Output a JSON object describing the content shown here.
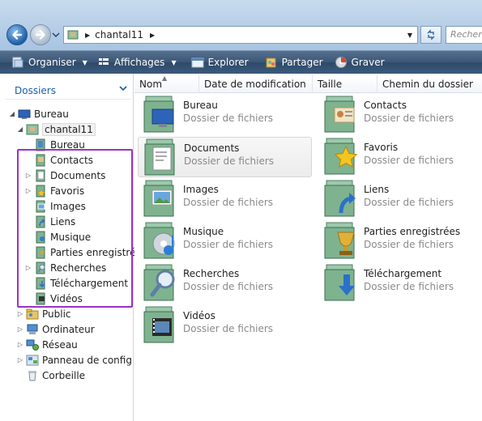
{
  "address": {
    "path": "chantal11",
    "search_placeholder": "Recherche"
  },
  "toolbar": {
    "organize": "Organiser",
    "views": "Affichages",
    "explore": "Explorer",
    "share": "Partager",
    "burn": "Graver"
  },
  "nav": {
    "header": "Dossiers",
    "tree": [
      {
        "label": "Bureau",
        "icon": "desktop-icon"
      },
      {
        "label": "chantal11",
        "icon": "user-folder-icon"
      },
      {
        "label": "Bureau",
        "icon": "desktop-folder-icon"
      },
      {
        "label": "Contacts",
        "icon": "contacts-folder-icon"
      },
      {
        "label": "Documents",
        "icon": "documents-folder-icon"
      },
      {
        "label": "Favoris",
        "icon": "favorites-folder-icon"
      },
      {
        "label": "Images",
        "icon": "pictures-folder-icon"
      },
      {
        "label": "Liens",
        "icon": "links-folder-icon"
      },
      {
        "label": "Musique",
        "icon": "music-folder-icon"
      },
      {
        "label": "Parties enregistrées",
        "icon": "saved-games-folder-icon"
      },
      {
        "label": "Recherches",
        "icon": "searches-folder-icon"
      },
      {
        "label": "Téléchargement",
        "icon": "downloads-folder-icon"
      },
      {
        "label": "Vidéos",
        "icon": "videos-folder-icon"
      },
      {
        "label": "Public",
        "icon": "public-folder-icon"
      },
      {
        "label": "Ordinateur",
        "icon": "computer-icon"
      },
      {
        "label": "Réseau",
        "icon": "network-icon"
      },
      {
        "label": "Panneau de configuration",
        "icon": "control-panel-icon"
      },
      {
        "label": "Corbeille",
        "icon": "recycle-bin-icon"
      }
    ]
  },
  "columns": {
    "name": "Nom",
    "modified": "Date de modification",
    "size": "Taille",
    "path": "Chemin du dossier"
  },
  "items": [
    {
      "name": "Bureau",
      "type": "Dossier de fichiers",
      "icon": "desktop-folder-icon"
    },
    {
      "name": "Contacts",
      "type": "Dossier de fichiers",
      "icon": "contacts-folder-icon"
    },
    {
      "name": "Documents",
      "type": "Dossier de fichiers",
      "icon": "documents-folder-icon"
    },
    {
      "name": "Favoris",
      "type": "Dossier de fichiers",
      "icon": "favorites-folder-icon"
    },
    {
      "name": "Images",
      "type": "Dossier de fichiers",
      "icon": "pictures-folder-icon"
    },
    {
      "name": "Liens",
      "type": "Dossier de fichiers",
      "icon": "links-folder-icon"
    },
    {
      "name": "Musique",
      "type": "Dossier de fichiers",
      "icon": "music-folder-icon"
    },
    {
      "name": "Parties enregistrées",
      "type": "Dossier de fichiers",
      "icon": "saved-games-folder-icon"
    },
    {
      "name": "Recherches",
      "type": "Dossier de fichiers",
      "icon": "searches-folder-icon"
    },
    {
      "name": "Téléchargement",
      "type": "Dossier de fichiers",
      "icon": "downloads-folder-icon"
    },
    {
      "name": "Vidéos",
      "type": "Dossier de fichiers",
      "icon": "videos-folder-icon"
    }
  ],
  "colors": {
    "accent": "#1a5ca8",
    "highlight_border": "#9a32c6",
    "folder_green": "#7fb38f"
  }
}
